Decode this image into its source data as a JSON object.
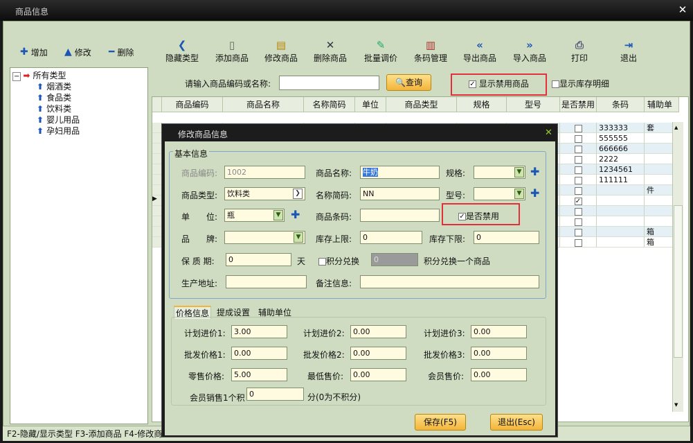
{
  "window": {
    "title": "商品信息"
  },
  "toolbar": {
    "add": "增加",
    "edit": "修改",
    "del": "删除",
    "buttons": [
      "隐藏类型",
      "添加商品",
      "修改商品",
      "删除商品",
      "批量调价",
      "条码管理",
      "导出商品",
      "导入商品",
      "打印",
      "退出"
    ]
  },
  "tree": {
    "root": "所有类型",
    "children": [
      "烟酒类",
      "食品类",
      "饮料类",
      "婴儿用品",
      "孕妇用品"
    ]
  },
  "search": {
    "label": "请输入商品编码或名称:",
    "value": "",
    "button": "查询",
    "show_disabled": "显示禁用商品",
    "show_stock": "显示库存明细"
  },
  "grid": {
    "headers": [
      "商品编码",
      "商品名称",
      "名称简码",
      "单位",
      "商品类型",
      "规格",
      "型号",
      "是否禁用",
      "条码",
      "辅助单"
    ],
    "barcodes": [
      "333333",
      "555555",
      "666666",
      "2222",
      "1234561",
      "111111",
      "",
      "",
      "",
      "",
      "",
      ""
    ],
    "aux": [
      "套",
      "",
      "",
      "",
      "",
      "",
      "件",
      "",
      "",
      "",
      "箱",
      "箱"
    ]
  },
  "status": {
    "text": "F2-隐藏/显示类型  F3-添加商品  F4-修改商"
  },
  "dialog": {
    "title": "修改商品信息",
    "basic_group": "基本信息",
    "code_label": "商品编码:",
    "code_value": "1002",
    "name_label": "商品名称:",
    "name_value": "牛奶",
    "spec_label": "规格:",
    "type_label": "商品类型:",
    "type_value": "饮料类",
    "abbr_label": "名称简码:",
    "abbr_value": "NN",
    "model_label": "型号:",
    "unit_label": "单　　位:",
    "unit_value": "瓶",
    "barcode_label": "商品条码:",
    "disabled_label": "是否禁用",
    "brand_label": "品　　牌:",
    "stock_max_label": "库存上限:",
    "stock_max_value": "0",
    "stock_min_label": "库存下限:",
    "stock_min_value": "0",
    "shelf_label": "保 质 期:",
    "shelf_value": "0",
    "shelf_unit": "天",
    "points_label": "积分兑换",
    "points_value": "0",
    "points_note": "积分兑换一个商品",
    "addr_label": "生产地址:",
    "note_label": "备注信息:",
    "tabs": [
      "价格信息",
      "提成设置",
      "辅助单位"
    ],
    "plan1_label": "计划进价1:",
    "plan1_value": "3.00",
    "plan2_label": "计划进价2:",
    "plan2_value": "0.00",
    "plan3_label": "计划进价3:",
    "plan3_value": "0.00",
    "whole1_label": "批发价格1:",
    "whole1_value": "0.00",
    "whole2_label": "批发价格2:",
    "whole2_value": "0.00",
    "whole3_label": "批发价格3:",
    "whole3_value": "0.00",
    "retail_label": "零售价格:",
    "retail_value": "5.00",
    "min_label": "最低售价:",
    "min_value": "0.00",
    "member_label": "会员售价:",
    "member_value": "0.00",
    "mpoints_label": "会员销售1个积",
    "mpoints_value": "0",
    "mpoints_note": "分(0为不积分)",
    "save": "保存(F5)",
    "exit": "退出(Esc)"
  },
  "colors": {
    "frame": "#cfdcc1",
    "highlight": "#e0303a",
    "accent": "#1c56b5"
  }
}
